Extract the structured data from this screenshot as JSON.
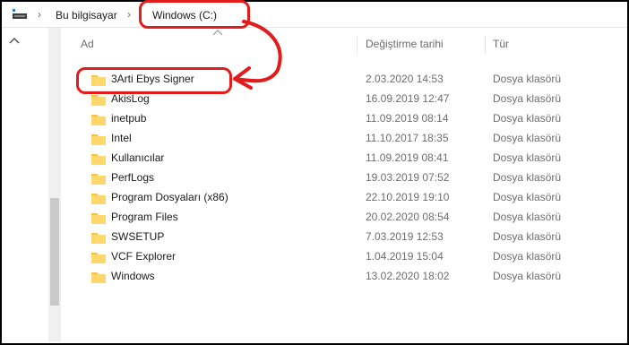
{
  "breadcrumb": {
    "pc_label": "Bu bilgisayar",
    "separator": "›",
    "drive_label": "Windows (C:)"
  },
  "columns": {
    "name": "Ad",
    "date_modified": "Değiştirme tarihi",
    "type": "Tür"
  },
  "files": [
    {
      "name": "3Arti Ebys Signer",
      "date": "2.03.2020 14:53",
      "type": "Dosya klasörü"
    },
    {
      "name": "AkisLog",
      "date": "16.09.2019 12:47",
      "type": "Dosya klasörü"
    },
    {
      "name": "inetpub",
      "date": "11.09.2019 08:14",
      "type": "Dosya klasörü"
    },
    {
      "name": "Intel",
      "date": "11.10.2017 18:35",
      "type": "Dosya klasörü"
    },
    {
      "name": "Kullanıcılar",
      "date": "11.09.2019 08:41",
      "type": "Dosya klasörü"
    },
    {
      "name": "PerfLogs",
      "date": "19.03.2019 07:52",
      "type": "Dosya klasörü"
    },
    {
      "name": "Program Dosyaları (x86)",
      "date": "22.10.2019 19:10",
      "type": "Dosya klasörü"
    },
    {
      "name": "Program Files",
      "date": "20.02.2020 08:54",
      "type": "Dosya klasörü"
    },
    {
      "name": "SWSETUP",
      "date": "7.03.2019 12:53",
      "type": "Dosya klasörü"
    },
    {
      "name": "VCF Explorer",
      "date": "1.04.2019 15:04",
      "type": "Dosya klasörü"
    },
    {
      "name": "Windows",
      "date": "13.02.2020 18:02",
      "type": "Dosya klasörü"
    }
  ],
  "icons": {
    "folder": "folder-icon",
    "pc": "computer-icon",
    "sort": "sort-caret-icon",
    "nav_up": "chevron-up-icon"
  },
  "colors": {
    "annotation": "#e21b1b",
    "folder": "#f5c04a",
    "secondary_text": "#6d6d6d"
  }
}
